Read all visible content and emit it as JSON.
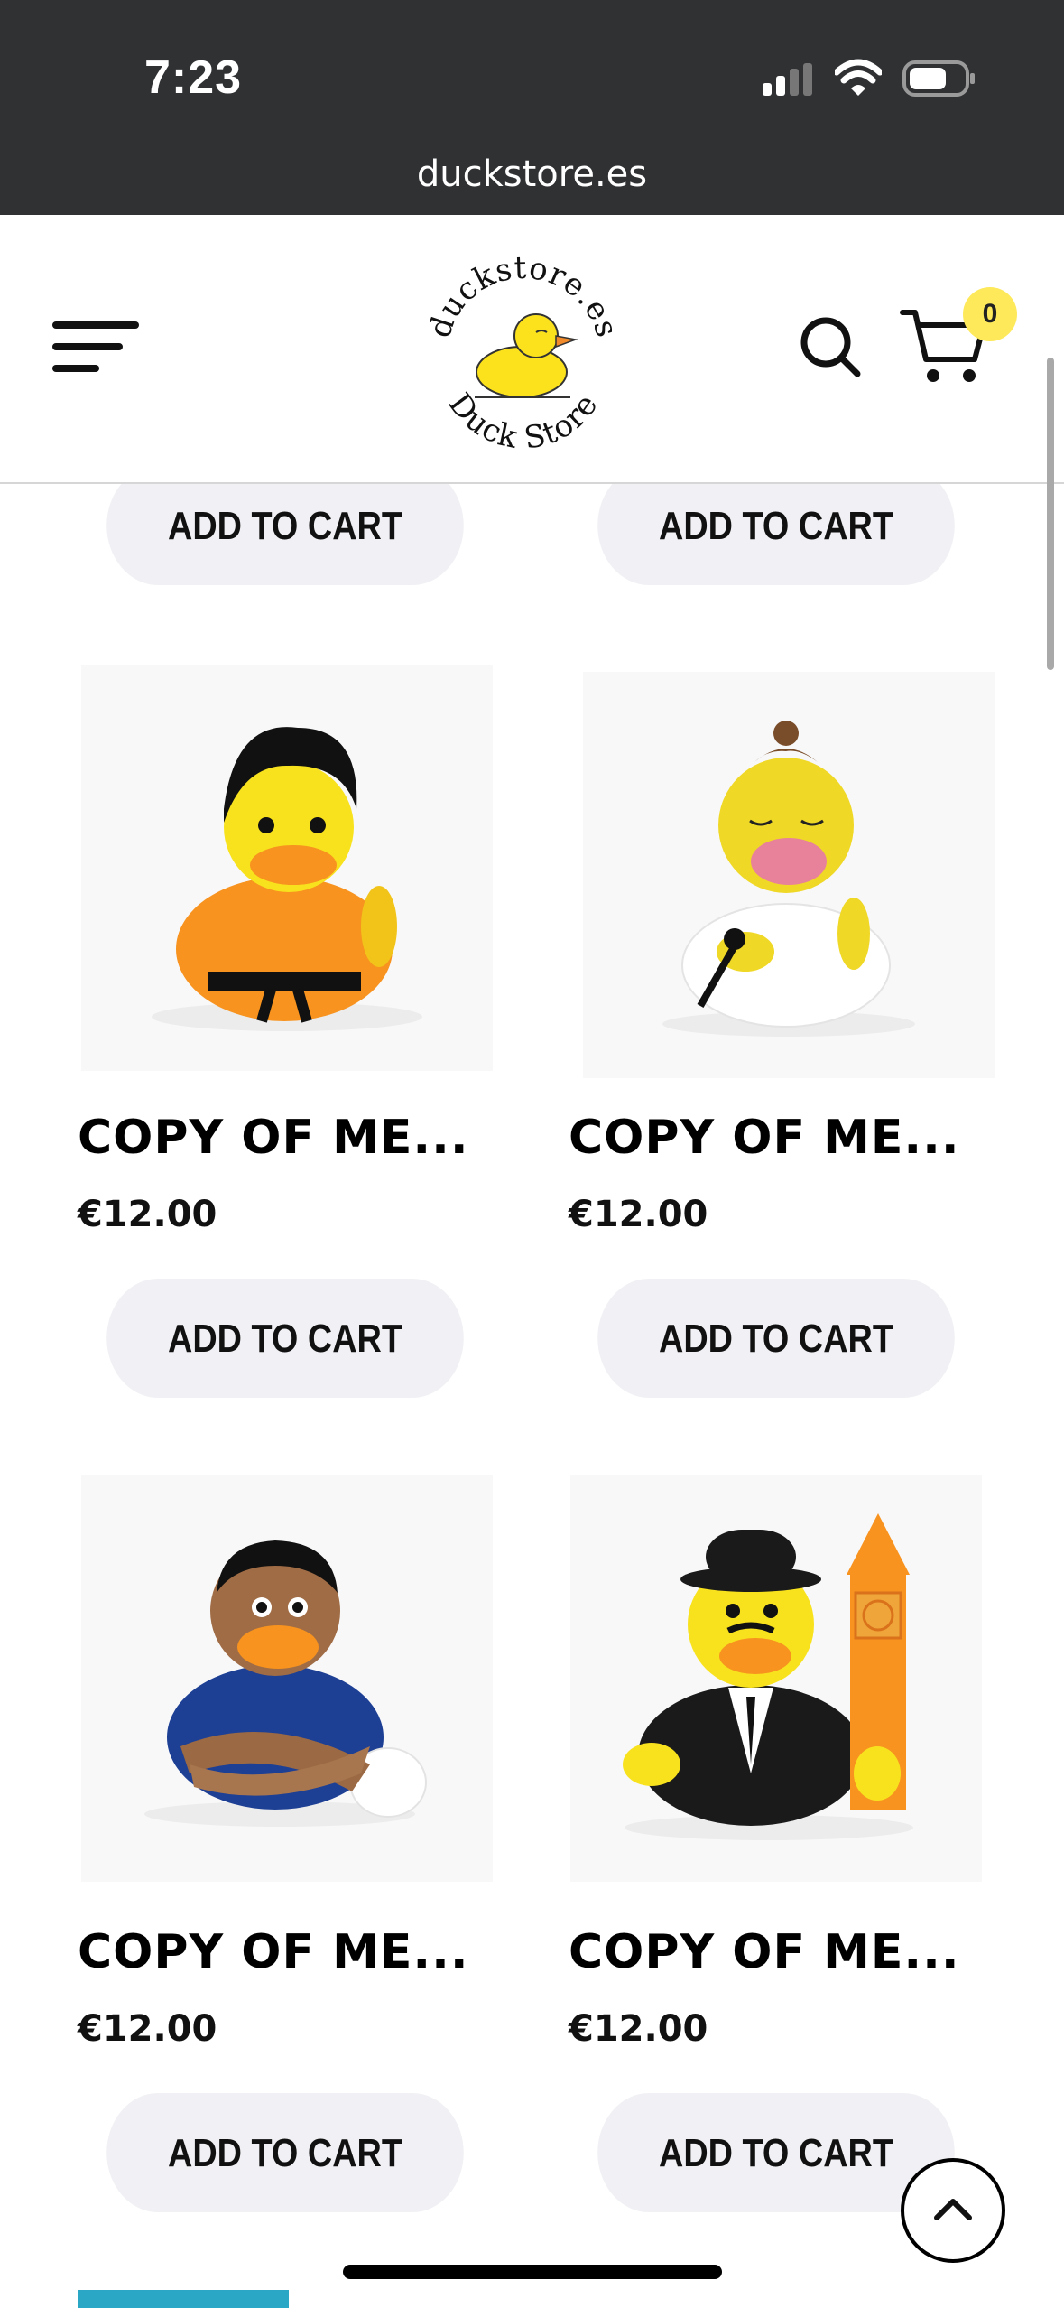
{
  "status_bar": {
    "time": "7:23"
  },
  "browser": {
    "url": "duckstore.es"
  },
  "header": {
    "logo_text_top": "duckstore.es",
    "logo_text_bottom": "Duck Store",
    "cart_count": "0"
  },
  "products": [
    {
      "title": "COPY OF ME...",
      "price": "€12.00",
      "add_to_cart": "ADD TO CART",
      "image": "karate-duck"
    },
    {
      "title": "COPY OF ME...",
      "price": "€12.00",
      "add_to_cart": "ADD TO CART",
      "image": "singer-duck"
    },
    {
      "title": "COPY OF ME...",
      "price": "€12.00",
      "add_to_cart": "ADD TO CART",
      "image": "football-duck"
    },
    {
      "title": "COPY OF ME...",
      "price": "€12.00",
      "add_to_cart": "ADD TO CART",
      "image": "london-duck"
    }
  ],
  "previous_row": {
    "add_to_cart_left": "ADD TO CART",
    "add_to_cart_right": "ADD TO CART"
  },
  "icons": [
    "menu-icon",
    "search-icon",
    "cart-icon",
    "chevron-up-icon"
  ]
}
